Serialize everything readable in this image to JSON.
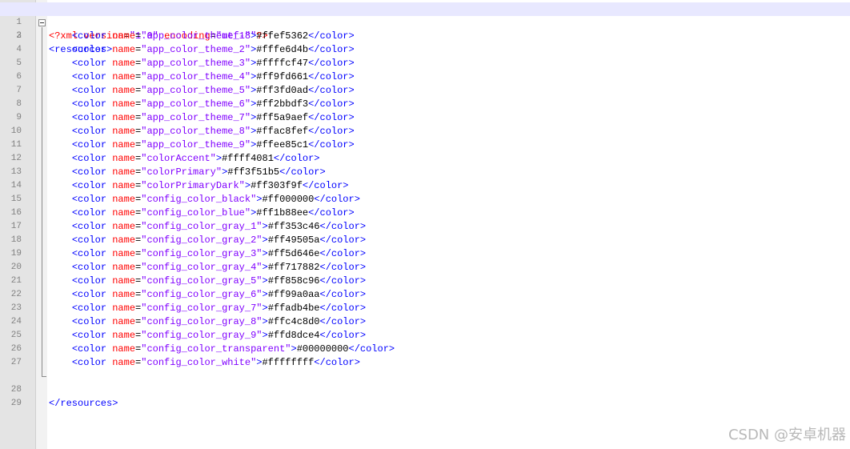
{
  "xml_declaration": {
    "open": "<?xml",
    "version_attr": "version",
    "version_value": "\"1.0\"",
    "encoding_attr": "encoding",
    "encoding_value": "\"utf-8\"",
    "close": "?>"
  },
  "resources_open": "<resources>",
  "resources_close": "</resources>",
  "color_tag_open": "<color",
  "color_tag_close": "</color>",
  "name_attr": "name",
  "colors": [
    {
      "name": "\"app_color_theme_1\"",
      "value": "#ffef5362"
    },
    {
      "name": "\"app_color_theme_2\"",
      "value": "#fffe6d4b"
    },
    {
      "name": "\"app_color_theme_3\"",
      "value": "#ffffcf47"
    },
    {
      "name": "\"app_color_theme_4\"",
      "value": "#ff9fd661"
    },
    {
      "name": "\"app_color_theme_5\"",
      "value": "#ff3fd0ad"
    },
    {
      "name": "\"app_color_theme_6\"",
      "value": "#ff2bbdf3"
    },
    {
      "name": "\"app_color_theme_7\"",
      "value": "#ff5a9aef"
    },
    {
      "name": "\"app_color_theme_8\"",
      "value": "#ffac8fef"
    },
    {
      "name": "\"app_color_theme_9\"",
      "value": "#ffee85c1"
    },
    {
      "name": "\"colorAccent\"",
      "value": "#ffff4081"
    },
    {
      "name": "\"colorPrimary\"",
      "value": "#ff3f51b5"
    },
    {
      "name": "\"colorPrimaryDark\"",
      "value": "#ff303f9f"
    },
    {
      "name": "\"config_color_black\"",
      "value": "#ff000000"
    },
    {
      "name": "\"config_color_blue\"",
      "value": "#ff1b88ee"
    },
    {
      "name": "\"config_color_gray_1\"",
      "value": "#ff353c46"
    },
    {
      "name": "\"config_color_gray_2\"",
      "value": "#ff49505a"
    },
    {
      "name": "\"config_color_gray_3\"",
      "value": "#ff5d646e"
    },
    {
      "name": "\"config_color_gray_4\"",
      "value": "#ff717882"
    },
    {
      "name": "\"config_color_gray_5\"",
      "value": "#ff858c96"
    },
    {
      "name": "\"config_color_gray_6\"",
      "value": "#ff99a0aa"
    },
    {
      "name": "\"config_color_gray_7\"",
      "value": "#ffadb4be"
    },
    {
      "name": "\"config_color_gray_8\"",
      "value": "#ffc4c8d0"
    },
    {
      "name": "\"config_color_gray_9\"",
      "value": "#ffd8dce4"
    },
    {
      "name": "\"config_color_transparent\"",
      "value": "#00000000"
    },
    {
      "name": "\"config_color_white\"",
      "value": "#ffffffff"
    }
  ],
  "line_numbers": [
    "1",
    "2",
    "3",
    "4",
    "5",
    "6",
    "7",
    "8",
    "9",
    "10",
    "11",
    "12",
    "13",
    "14",
    "15",
    "16",
    "17",
    "18",
    "19",
    "20",
    "21",
    "22",
    "23",
    "24",
    "25",
    "26",
    "27",
    "28",
    "29"
  ],
  "watermark": "CSDN @安卓机器",
  "theme": {
    "tag_color": "#0000ff",
    "attr_color": "#ff0000",
    "value_color": "#8000ff",
    "current_line_bg": "#e8e8ff"
  }
}
